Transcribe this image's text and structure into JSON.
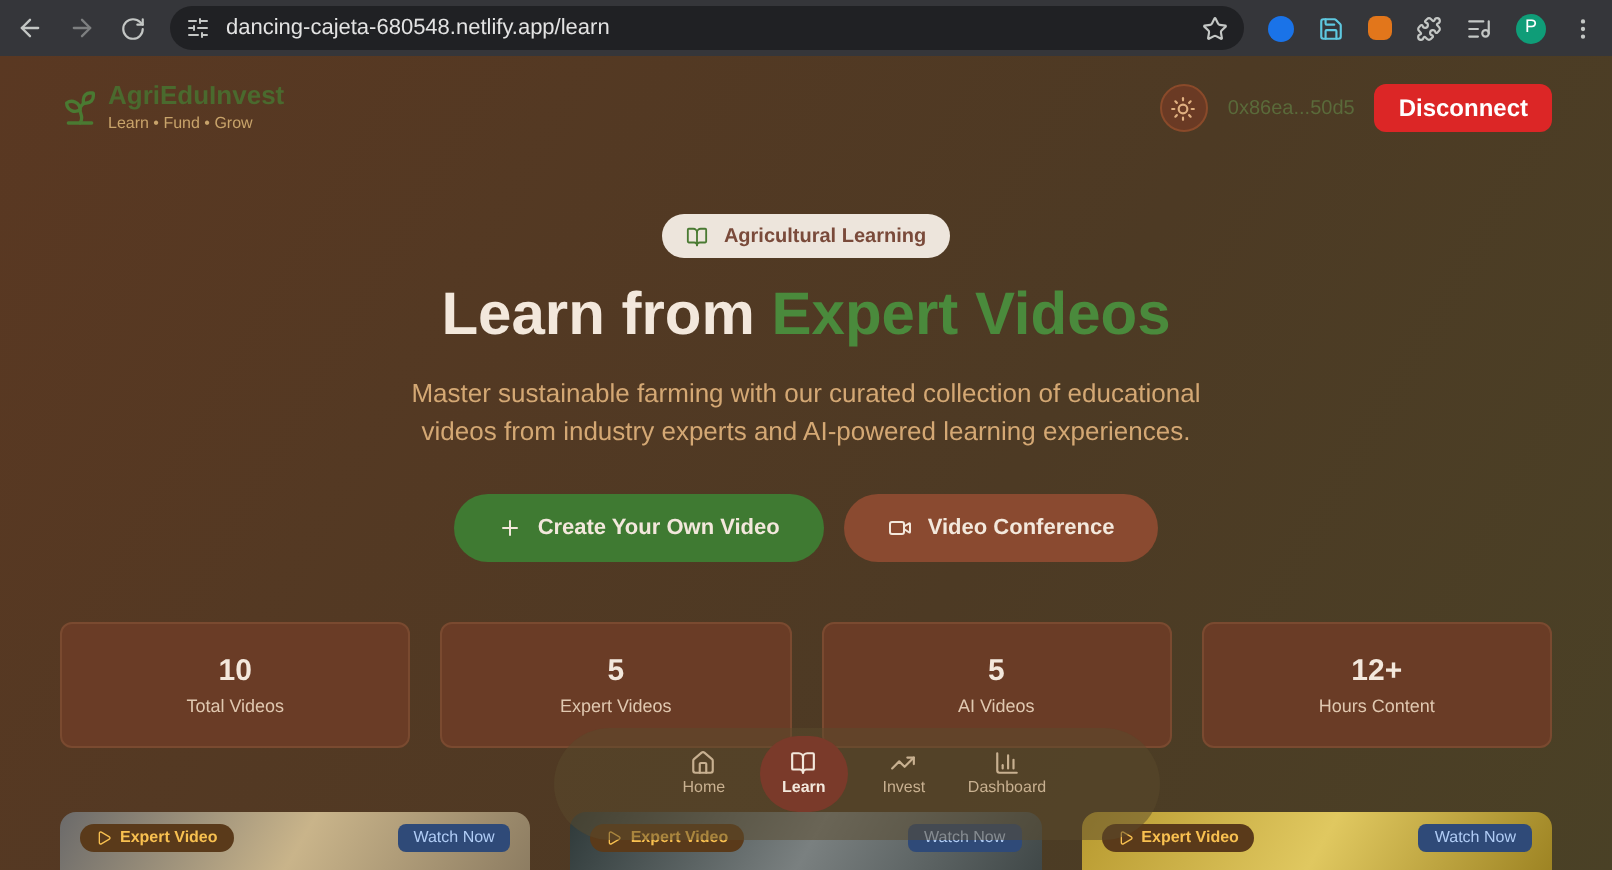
{
  "browser": {
    "url": "dancing-cajeta-680548.netlify.app/learn",
    "profile_initial": "P"
  },
  "header": {
    "brand": "AgriEduInvest",
    "tagline": "Learn • Fund • Grow",
    "wallet": "0x86ea...50d5",
    "disconnect": "Disconnect"
  },
  "hero": {
    "badge": "Agricultural Learning",
    "title_lead": "Learn from",
    "title_highlight": "Expert Videos",
    "subtitle": "Master sustainable farming with our curated collection of educational videos from industry experts and AI-powered learning experiences.",
    "buttons": [
      {
        "label": "Create Your Own Video",
        "kind": "create"
      },
      {
        "label": "Video Conference",
        "kind": "conference"
      }
    ]
  },
  "stats": [
    {
      "value": "10",
      "label": "Total Videos"
    },
    {
      "value": "5",
      "label": "Expert Videos"
    },
    {
      "value": "5",
      "label": "AI Videos"
    },
    {
      "value": "12+",
      "label": "Hours Content"
    }
  ],
  "videos": [
    {
      "badge": "Expert Video",
      "action": "Watch Now"
    },
    {
      "badge": "Expert Video",
      "action": "Watch Now"
    },
    {
      "badge": "Expert Video",
      "action": "Watch Now"
    }
  ],
  "nav": [
    {
      "label": "Home",
      "selected": false
    },
    {
      "label": "Learn",
      "selected": true
    },
    {
      "label": "Invest",
      "selected": false
    },
    {
      "label": "Dashboard",
      "selected": false
    }
  ]
}
